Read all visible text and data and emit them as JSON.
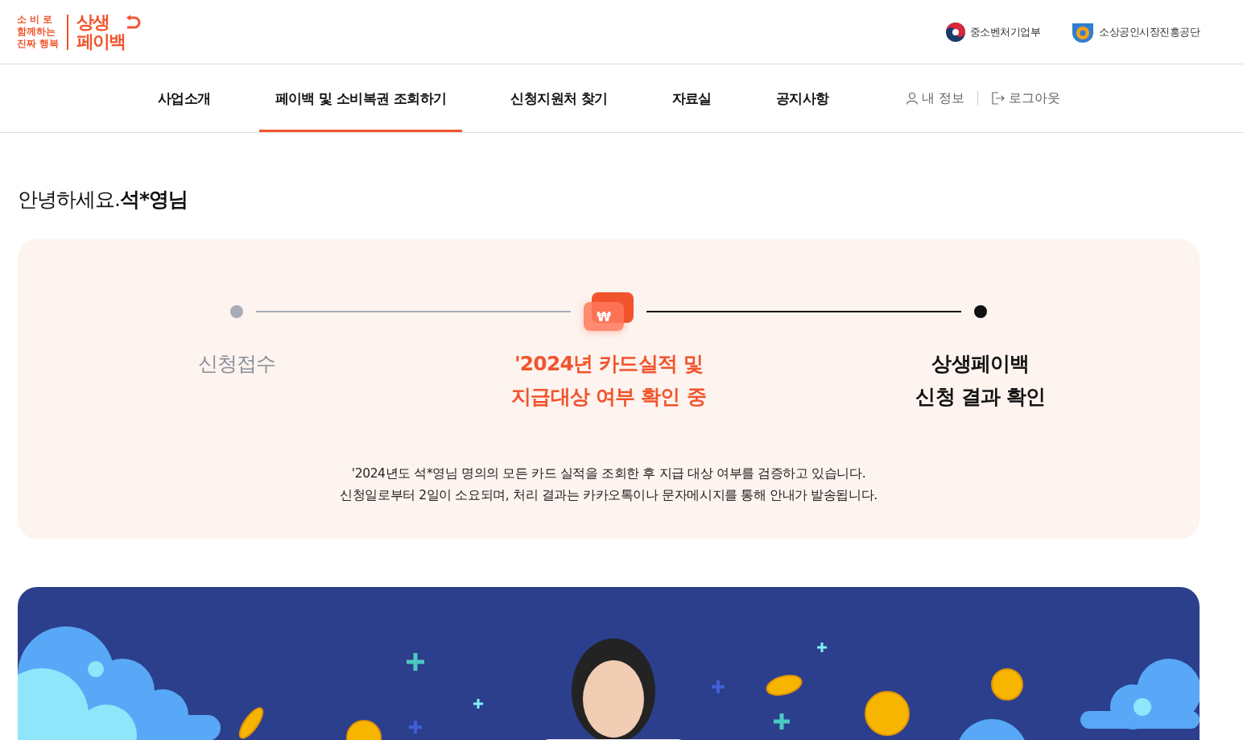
{
  "logo": {
    "slogan": [
      "소 비 로",
      "함께하는",
      "진짜 행복"
    ],
    "brand": [
      "상생",
      "페이백"
    ]
  },
  "partners": [
    "중소벤처기업부",
    "소상공인시장진흥공단"
  ],
  "nav": [
    {
      "label": "사업소개",
      "selected": false
    },
    {
      "label": "페이백 및 소비복권 조회하기",
      "selected": true
    },
    {
      "label": "신청지원처 찾기",
      "selected": false
    },
    {
      "label": "자료실",
      "selected": false
    },
    {
      "label": "공지사항",
      "selected": false
    }
  ],
  "user_links": [
    {
      "kind": "profile",
      "label": "내 정보"
    },
    {
      "kind": "logout",
      "label": "로그아웃"
    }
  ],
  "greeting": "안녕하세요.**석*영님**",
  "progress": {
    "current_badge": "₩",
    "steps": [
      {
        "kind": "done",
        "lines": [
          "신청접수"
        ]
      },
      {
        "kind": "current",
        "lines": [
          "'2024년 카드실적 및",
          "지급대상 여부 확인 중"
        ]
      },
      {
        "kind": "upcoming",
        "lines": [
          "상생페이백",
          "신청 결과 확인"
        ]
      }
    ],
    "description": [
      "'2024년도 석*영님 명의의 모든 카드 실적을 조회한 후 지급 대상 여부를 검증하고 있습니다.",
      "신청일로부터 2일이 소요되며, 처리 결과는 카카오톡이나 문자메시지를 통해 안내가 발송됩니다."
    ]
  }
}
